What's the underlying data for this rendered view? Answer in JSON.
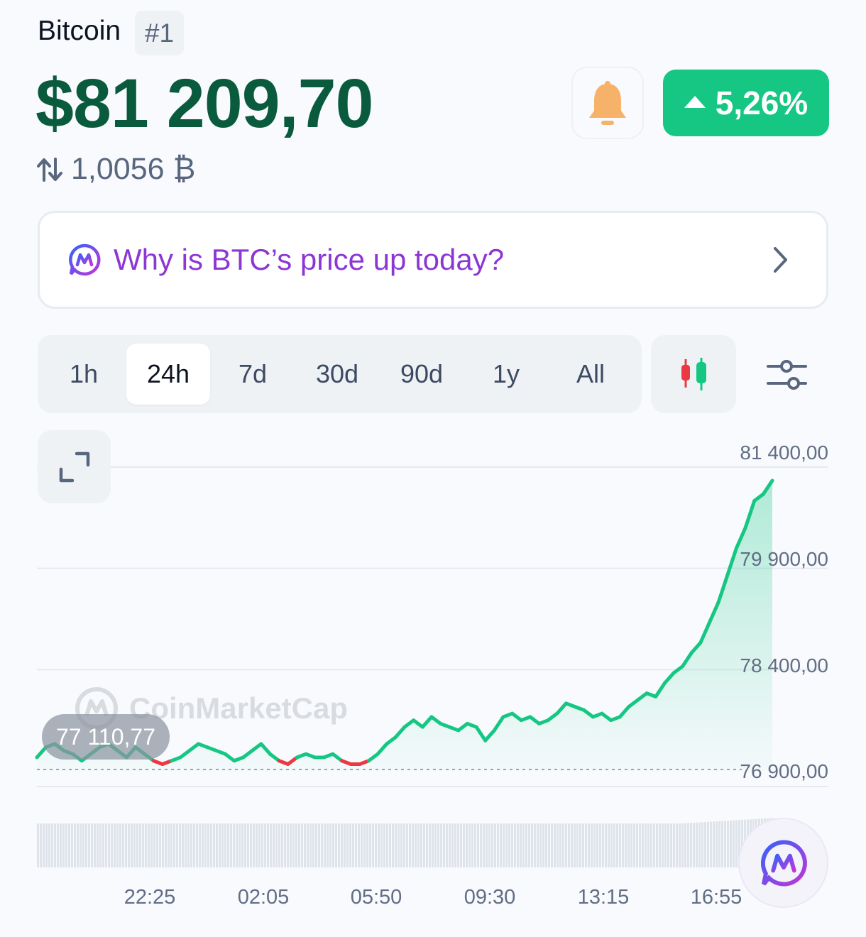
{
  "coin": {
    "name": "Bitcoin",
    "rank": "#1"
  },
  "price": "$81 209,70",
  "btc_amount": "1,0056 ₿",
  "change": {
    "value": "5,26%",
    "direction": "up",
    "color": "#16c784"
  },
  "why_card": {
    "text": "Why is BTC’s price up today?",
    "accent": "#8c36d6"
  },
  "tabs": [
    "1h",
    "24h",
    "7d",
    "30d",
    "90d",
    "1y",
    "All"
  ],
  "active_tab": "24h",
  "chart_data": {
    "type": "line",
    "y_ticks": [
      "81 400,00",
      "79 900,00",
      "78 400,00",
      "76 900,00"
    ],
    "ylim": [
      76700,
      81600
    ],
    "x_ticks": [
      "22:25",
      "02:05",
      "05:50",
      "09:30",
      "13:15",
      "16:55"
    ],
    "reference_label": "77 110,77",
    "reference_value": 77110.77,
    "watermark": "CoinMarketCap",
    "up_color": "#16c784",
    "down_color": "#ea3943",
    "series": [
      {
        "values": [
          77100,
          77250,
          77300,
          77200,
          77150,
          77050,
          77150,
          77250,
          77300,
          77200,
          77100,
          77250,
          77150,
          77050,
          77000,
          77050,
          77100,
          77200,
          77300,
          77250,
          77200,
          77150,
          77050,
          77100,
          77200,
          77300,
          77150,
          77050,
          77000,
          77100,
          77150,
          77100,
          77100,
          77150,
          77050,
          77000,
          77000,
          77050,
          77150,
          77300,
          77400,
          77550,
          77650,
          77550,
          77700,
          77600,
          77550,
          77500,
          77600,
          77550,
          77350,
          77500,
          77700,
          77750,
          77650,
          77700,
          77600,
          77650,
          77750,
          77900,
          77850,
          77800,
          77700,
          77750,
          77650,
          77700,
          77850,
          77950,
          78050,
          78000,
          78200,
          78350,
          78450,
          78650,
          78800,
          79100,
          79400,
          79800,
          80200,
          80500,
          80900,
          81000,
          81200
        ]
      }
    ],
    "volume_hint": "uniform-bars"
  }
}
